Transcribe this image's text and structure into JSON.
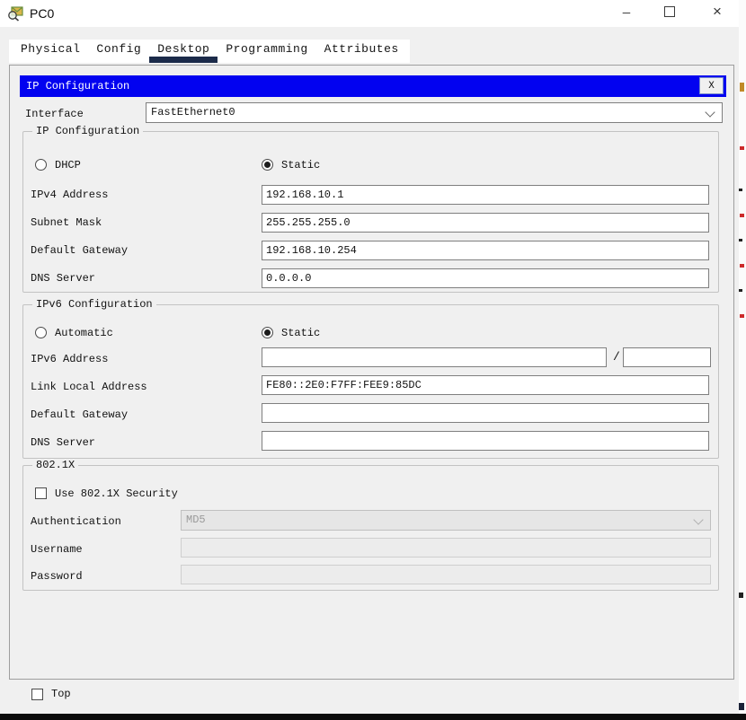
{
  "window": {
    "title": "PC0",
    "minimize_glyph": "—",
    "close_glyph": "×"
  },
  "tabs": {
    "items": [
      {
        "label": "Physical",
        "active": false
      },
      {
        "label": "Config",
        "active": false
      },
      {
        "label": "Desktop",
        "active": true
      },
      {
        "label": "Programming",
        "active": false
      },
      {
        "label": "Attributes",
        "active": false
      }
    ]
  },
  "ip_configuration": {
    "title_bar": {
      "title": "IP Configuration",
      "close_label": "X"
    },
    "interface_row": {
      "label": "Interface",
      "value": "FastEthernet0"
    },
    "ipv4": {
      "legend": "IP Configuration",
      "dhcp_radio": {
        "label": "DHCP",
        "selected": false
      },
      "static_radio": {
        "label": "Static",
        "selected": true
      },
      "address": {
        "label": "IPv4 Address",
        "value": "192.168.10.1"
      },
      "subnet": {
        "label": "Subnet Mask",
        "value": "255.255.255.0"
      },
      "gateway": {
        "label": "Default Gateway",
        "value": "192.168.10.254"
      },
      "dns": {
        "label": "DNS Server",
        "value": "0.0.0.0"
      }
    },
    "ipv6": {
      "legend": "IPv6 Configuration",
      "automatic_radio": {
        "label": "Automatic",
        "selected": false
      },
      "static_radio": {
        "label": "Static",
        "selected": true
      },
      "address": {
        "label": "IPv6 Address",
        "value": "",
        "separator": "/",
        "prefix_value": ""
      },
      "link_local": {
        "label": "Link Local Address",
        "value": "FE80::2E0:F7FF:FEE9:85DC"
      },
      "gateway": {
        "label": "Default Gateway",
        "value": ""
      },
      "dns": {
        "label": "DNS Server",
        "value": ""
      }
    },
    "dot1x": {
      "legend": "802.1X",
      "use_security_checkbox": {
        "label": "Use 802.1X Security",
        "checked": false
      },
      "authentication": {
        "label": "Authentication",
        "value": "MD5",
        "disabled": true
      },
      "username": {
        "label": "Username",
        "value": "",
        "disabled": true
      },
      "password": {
        "label": "Password",
        "value": "",
        "disabled": true
      }
    }
  },
  "footer": {
    "top_checkbox": {
      "label": "Top",
      "checked": false
    }
  },
  "icons": {
    "app": "packet-tracer-logo",
    "minimize": "minimize-icon",
    "maximize": "maximize-icon",
    "close": "close-icon",
    "combo": "chevron-down-icon"
  },
  "colors": {
    "header_blue": "#0202f0",
    "tab_underline_navy": "#1c2b4a",
    "dialog_bg": "#f0f0f0",
    "titlebar_bg": "#ffffff",
    "disabled_text": "#9a9a9a",
    "bottom_bar": "#0b0b0b"
  }
}
